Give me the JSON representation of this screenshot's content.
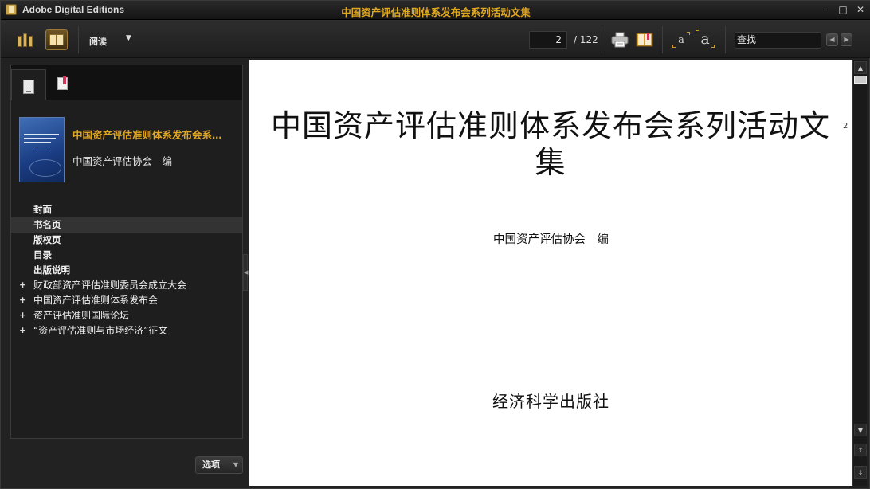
{
  "titlebar": {
    "app_name": "Adobe Digital Editions",
    "document_title": "中国资产评估准则体系发布会系列活动文集",
    "minimize": "–",
    "maximize": "□",
    "close": "✕"
  },
  "toolbar": {
    "view_mode_label": "阅读",
    "dropdown_arrow": "▼",
    "current_page": "2",
    "total_pages": "/ 122",
    "font_small": "a",
    "font_large": "a",
    "search_placeholder": "查找",
    "prev_arrow": "◀",
    "next_arrow": "▶"
  },
  "sidebar": {
    "book": {
      "title": "中国资产评估准则体系发布会系…",
      "author": "中国资产评估协会　编"
    },
    "toc": [
      {
        "label": "封面",
        "bold": true
      },
      {
        "label": "书名页",
        "bold": true,
        "selected": true
      },
      {
        "label": "版权页",
        "bold": true
      },
      {
        "label": "目录",
        "bold": true
      },
      {
        "label": "出版说明",
        "bold": true
      },
      {
        "label": "财政部资产评估准则委员会成立大会",
        "expandable": true
      },
      {
        "label": "中国资产评估准则体系发布会",
        "expandable": true
      },
      {
        "label": "资产评估准则国际论坛",
        "expandable": true
      },
      {
        "label": "“资产评估准则与市场经济”征文",
        "expandable": true
      }
    ],
    "options_label": "选项",
    "options_arrow": "▼",
    "splitter_arrow": "◀"
  },
  "page": {
    "title": "中国资产评估准则体系发布会系列活动文集",
    "page_marker": "2",
    "author": "中国资产评估协会　编",
    "publisher": "经济科学出版社"
  },
  "scrollbar": {
    "up": "▲",
    "down": "▼",
    "page_up": "⇑",
    "page_down": "⇓"
  },
  "colors": {
    "accent": "#e0a820",
    "background": "#222222",
    "page": "#ffffff"
  }
}
